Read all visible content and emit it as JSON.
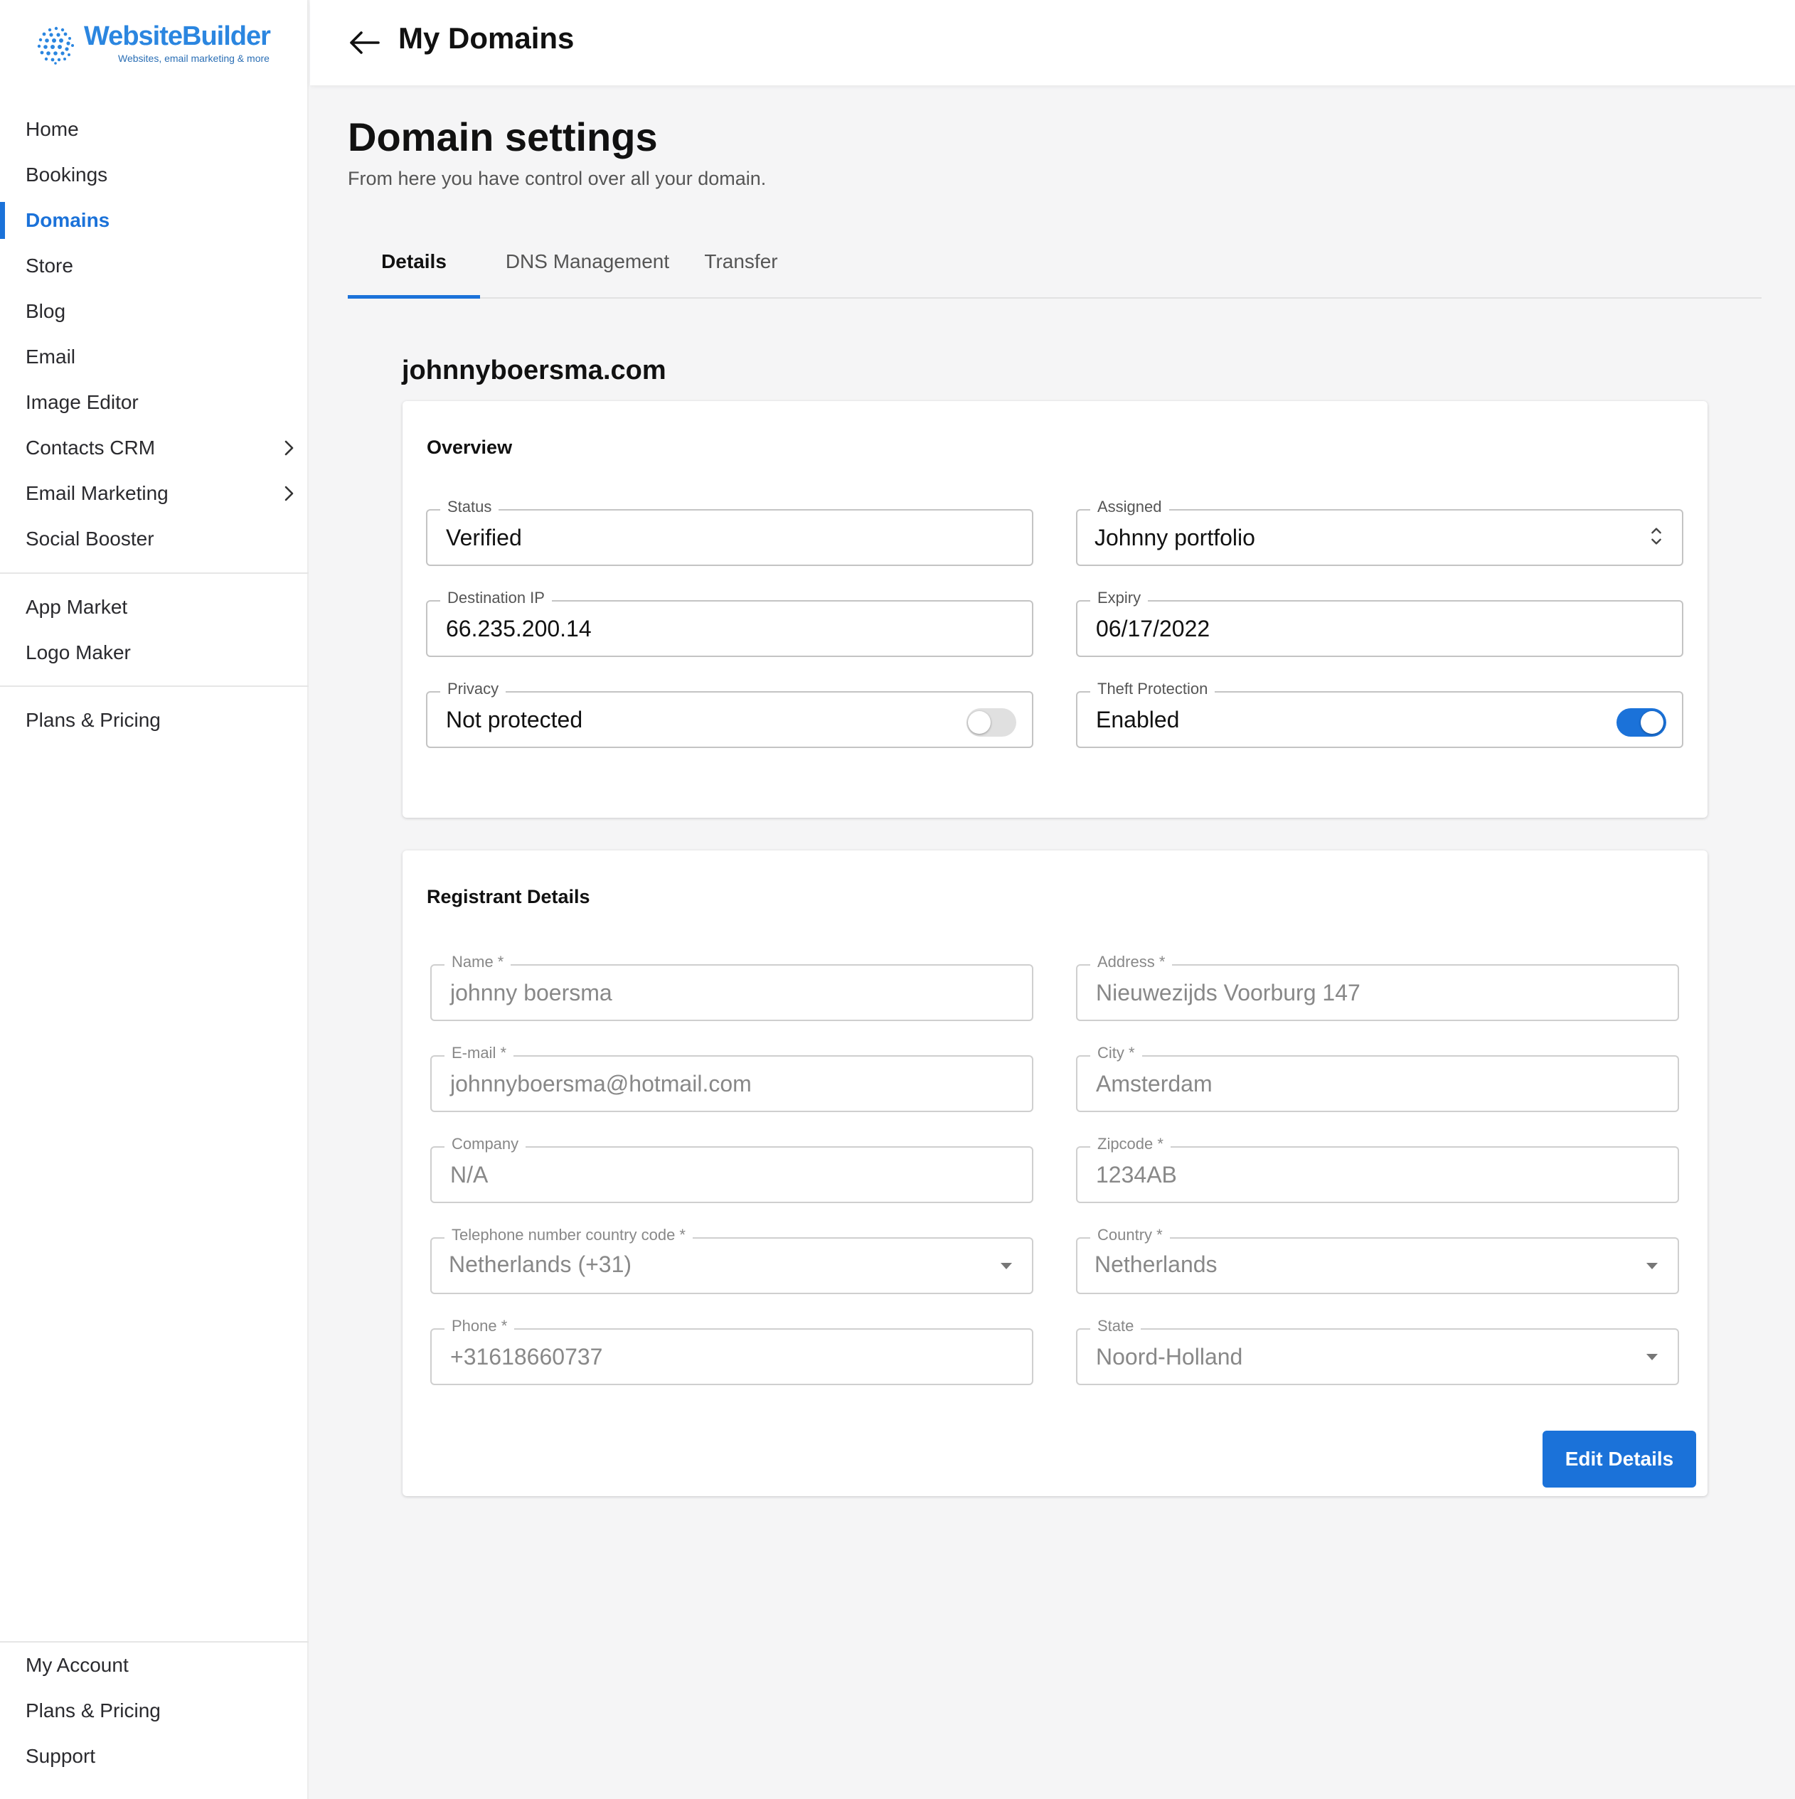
{
  "brand": {
    "name": "WebsiteBuilder",
    "tagline": "Websites, email marketing & more",
    "color": "#2b86e0"
  },
  "sidebar": {
    "main_items": [
      {
        "label": "Home"
      },
      {
        "label": "Bookings"
      },
      {
        "label": "Domains",
        "active": true
      },
      {
        "label": "Store"
      },
      {
        "label": "Blog"
      },
      {
        "label": "Email"
      },
      {
        "label": "Image Editor"
      },
      {
        "label": "Contacts CRM",
        "icon": "chevron-right-icon"
      },
      {
        "label": "Email Marketing",
        "icon": "chevron-right-icon"
      },
      {
        "label": "Social Booster"
      }
    ],
    "secondary_items": [
      {
        "label": "App Market"
      },
      {
        "label": "Logo Maker"
      }
    ],
    "tertiary_items": [
      {
        "label": "Plans & Pricing"
      }
    ],
    "footer_items": [
      {
        "label": "My Account"
      },
      {
        "label": "Plans & Pricing"
      },
      {
        "label": "Support"
      }
    ]
  },
  "header": {
    "back_icon": "arrow-left-icon",
    "title": "My Domains"
  },
  "page": {
    "title": "Domain settings",
    "subtitle": "From here you have control over all your domain."
  },
  "tabs": [
    {
      "label": "Details",
      "active": true
    },
    {
      "label": "DNS Management"
    },
    {
      "label": "Transfer"
    }
  ],
  "domain": "johnnyboersma.com",
  "overview": {
    "title": "Overview",
    "status": {
      "label": "Status",
      "value": "Verified"
    },
    "assigned": {
      "label": "Assigned",
      "value": "Johnny portfolio",
      "icon": "unfold-icon"
    },
    "destination_ip": {
      "label": "Destination IP",
      "value": "66.235.200.14"
    },
    "expiry": {
      "label": "Expiry",
      "value": "06/17/2022"
    },
    "privacy": {
      "label": "Privacy",
      "value": "Not protected",
      "toggle_on": false
    },
    "theft_protection": {
      "label": "Theft Protection",
      "value": "Enabled",
      "toggle_on": true
    }
  },
  "registrant": {
    "title": "Registrant Details",
    "name": {
      "label": "Name *",
      "value": "johnny boersma"
    },
    "address": {
      "label": "Address *",
      "value": "Nieuwezijds Voorburg 147"
    },
    "email": {
      "label": "E-mail *",
      "value": "johnnyboersma@hotmail.com"
    },
    "city": {
      "label": "City *",
      "value": "Amsterdam"
    },
    "company": {
      "label": "Company",
      "value": "N/A"
    },
    "zipcode": {
      "label": "Zipcode *",
      "value": "1234AB"
    },
    "phone_country_code": {
      "label": "Telephone number country code *",
      "value": "Netherlands (+31)",
      "icon": "caret-down-icon"
    },
    "country": {
      "label": "Country *",
      "value": "Netherlands",
      "icon": "caret-down-icon"
    },
    "phone": {
      "label": "Phone *",
      "value": "+31618660737"
    },
    "state": {
      "label": "State",
      "value": "Noord-Holland",
      "icon": "caret-down-icon"
    },
    "edit_button": "Edit Details"
  },
  "colors": {
    "accent": "#1b72d9",
    "background": "#f5f5f6"
  }
}
